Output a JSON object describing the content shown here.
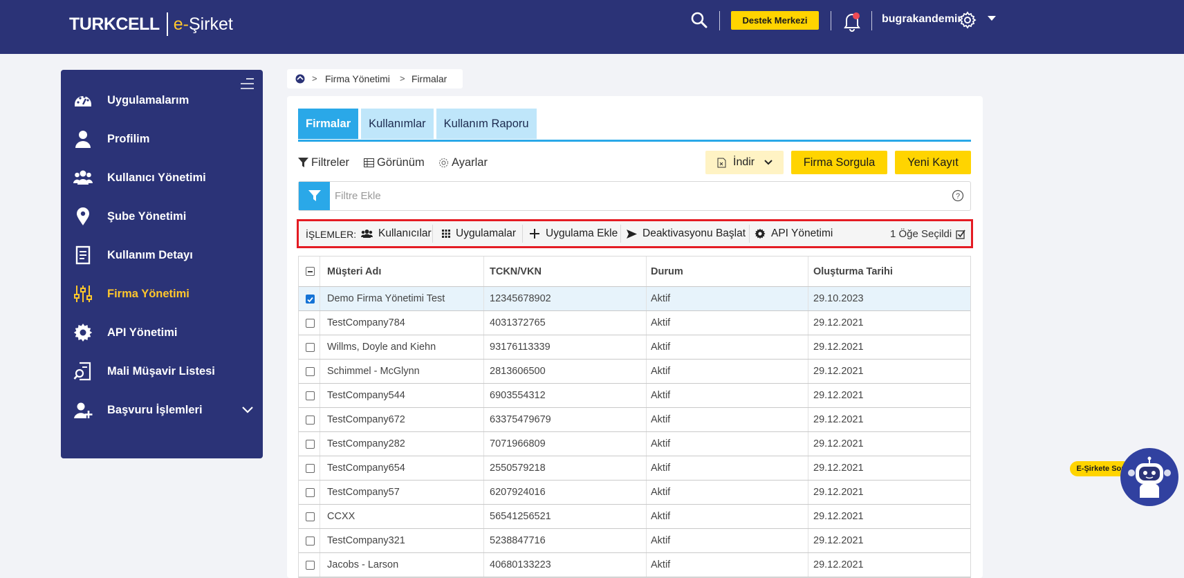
{
  "header": {
    "brand": "TURKCELL",
    "product_e": "e-",
    "product_name": "Şirket",
    "support_button": "Destek Merkezi",
    "username": "bugrakandemir",
    "colors": {
      "bar": "#2b3377",
      "accent": "#ffc72c",
      "support": "#ffd400"
    }
  },
  "sidebar": {
    "items": [
      {
        "label": "Uygulamalarım",
        "icon": "dashboard-icon"
      },
      {
        "label": "Profilim",
        "icon": "user-icon"
      },
      {
        "label": "Kullanıcı Yönetimi",
        "icon": "users-icon"
      },
      {
        "label": "Şube Yönetimi",
        "icon": "location-pin-icon"
      },
      {
        "label": "Kullanım Detayı",
        "icon": "document-icon"
      },
      {
        "label": "Firma Yönetimi",
        "icon": "sliders-icon",
        "active": true
      },
      {
        "label": "API Yönetimi",
        "icon": "gear-icon"
      },
      {
        "label": "Mali Müşavir Listesi",
        "icon": "document-search-icon"
      },
      {
        "label": "Başvuru İşlemleri",
        "icon": "user-add-icon",
        "expandable": true
      }
    ]
  },
  "breadcrumb": {
    "items": [
      "Firma Yönetimi",
      "Firmalar"
    ]
  },
  "tabs": [
    "Firmalar",
    "Kullanımlar",
    "Kullanım Raporu"
  ],
  "toolbar": {
    "filters": "Filtreler",
    "view": "Görünüm",
    "settings": "Ayarlar",
    "download": "İndir",
    "query": "Firma Sorgula",
    "new_record": "Yeni Kayıt"
  },
  "filter": {
    "placeholder": "Filtre Ekle"
  },
  "actions": {
    "label": "İŞLEMLER:",
    "users": "Kullanıcılar",
    "apps": "Uygulamalar",
    "add_app": "Uygulama Ekle",
    "deactivate": "Deaktivasyonu Başlat",
    "api": "API Yönetimi",
    "selected": "1 Öğe Seçildi"
  },
  "table": {
    "columns": [
      "Müşteri Adı",
      "TCKN/VKN",
      "Durum",
      "Oluşturma Tarihi"
    ],
    "rows": [
      {
        "name": "Demo Firma Yönetimi Test",
        "id": "12345678902",
        "status": "Aktif",
        "date": "29.10.2023",
        "checked": true
      },
      {
        "name": "TestCompany784",
        "id": "4031372765",
        "status": "Aktif",
        "date": "29.12.2021"
      },
      {
        "name": "Willms, Doyle and Kiehn",
        "id": "93176113339",
        "status": "Aktif",
        "date": "29.12.2021"
      },
      {
        "name": "Schimmel - McGlynn",
        "id": "2813606500",
        "status": "Aktif",
        "date": "29.12.2021"
      },
      {
        "name": "TestCompany544",
        "id": "6903554312",
        "status": "Aktif",
        "date": "29.12.2021"
      },
      {
        "name": "TestCompany672",
        "id": "63375479679",
        "status": "Aktif",
        "date": "29.12.2021"
      },
      {
        "name": "TestCompany282",
        "id": "7071966809",
        "status": "Aktif",
        "date": "29.12.2021"
      },
      {
        "name": "TestCompany654",
        "id": "2550579218",
        "status": "Aktif",
        "date": "29.12.2021"
      },
      {
        "name": "TestCompany57",
        "id": "6207924016",
        "status": "Aktif",
        "date": "29.12.2021"
      },
      {
        "name": "CCXX",
        "id": "56541256521",
        "status": "Aktif",
        "date": "29.12.2021"
      },
      {
        "name": "TestCompany321",
        "id": "5238847716",
        "status": "Aktif",
        "date": "29.12.2021"
      },
      {
        "name": "Jacobs - Larson",
        "id": "40680133223",
        "status": "Aktif",
        "date": "29.12.2021"
      }
    ]
  },
  "chatbot": {
    "label": "E-Şirkete Sor"
  }
}
